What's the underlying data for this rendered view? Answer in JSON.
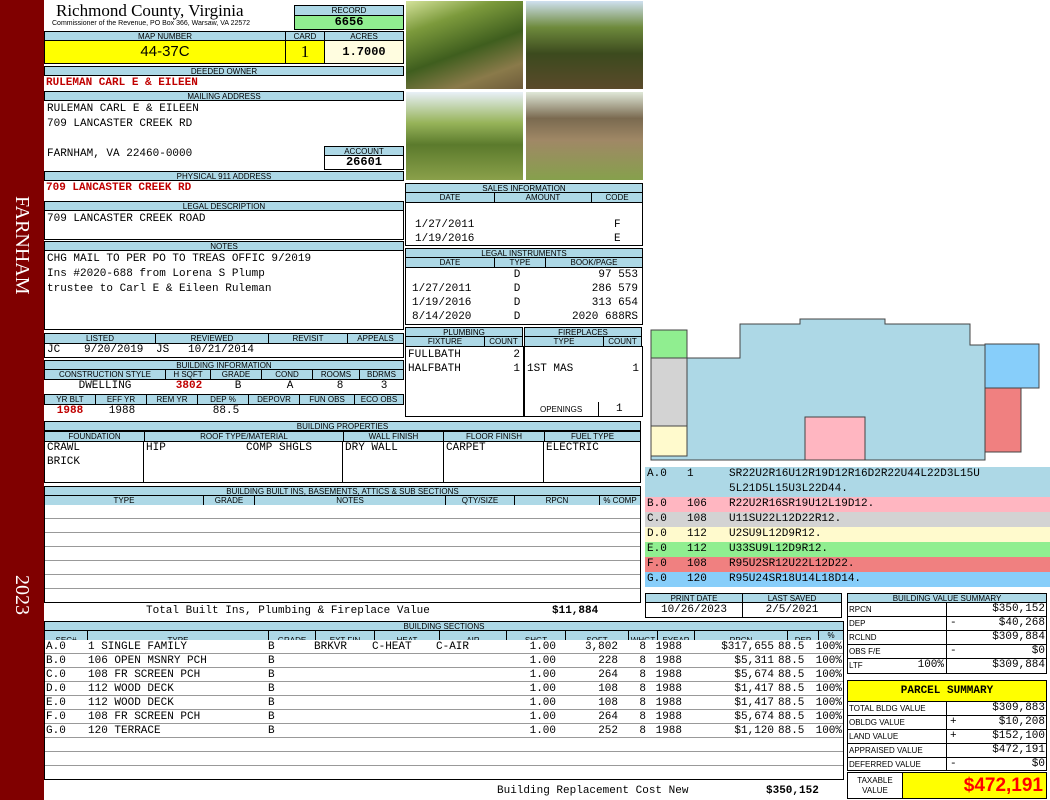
{
  "sidebar": {
    "town": "FARNHAM",
    "year": "2023",
    "color": "#800000"
  },
  "header": {
    "county": "Richmond County, Virginia",
    "office": "Commissioner of the Revenue, PO Box 366, Warsaw, VA 22572",
    "record_label": "RECORD",
    "record": "6656",
    "map_label": "MAP NUMBER",
    "map_number": "44-37C",
    "card_label": "CARD",
    "card": "1",
    "acres_label": "ACRES",
    "acres": "1.7000"
  },
  "owner": {
    "deeded_label": "DEEDED OWNER",
    "deeded": "RULEMAN CARL E & EILEEN",
    "mailing_label": "MAILING ADDRESS",
    "mail1": "RULEMAN CARL E & EILEEN",
    "mail2": "709 LANCASTER CREEK RD",
    "mail3": "FARNHAM, VA 22460-0000",
    "account_label": "ACCOUNT",
    "account": "26601",
    "physical_label": "PHYSICAL 911 ADDRESS",
    "physical": "709 LANCASTER CREEK RD",
    "legal_label": "LEGAL DESCRIPTION",
    "legal": "709 LANCASTER CREEK ROAD",
    "notes_label": "NOTES",
    "notes1": "CHG MAIL TO PER PO TO TREAS OFFIC 9/2019",
    "notes2": "Ins #2020-688 from Lorena S Plump",
    "notes3": "trustee to Carl E & Eileen Ruleman"
  },
  "sales": {
    "title": "SALES INFORMATION",
    "cols": [
      "DATE",
      "AMOUNT",
      "CODE"
    ],
    "rows": [
      {
        "date": "1/27/2011",
        "amount": "",
        "code": "F"
      },
      {
        "date": "1/19/2016",
        "amount": "",
        "code": "E"
      }
    ]
  },
  "instruments": {
    "title": "LEGAL INSTRUMENTS",
    "cols": [
      "DATE",
      "TYPE",
      "BOOK/PAGE"
    ],
    "rows": [
      {
        "date": "",
        "type": "D",
        "book": "97 553"
      },
      {
        "date": "1/27/2011",
        "type": "D",
        "book": "286 579"
      },
      {
        "date": "1/19/2016",
        "type": "D",
        "book": "313 654"
      },
      {
        "date": "8/14/2020",
        "type": "D",
        "book": "2020 688RS"
      }
    ]
  },
  "listing": {
    "cols": [
      "LISTED",
      "REVIEWED",
      "REVISIT",
      "APPEALS"
    ],
    "listed_by": "JC",
    "listed": "9/20/2019",
    "reviewed_by": "JS",
    "reviewed": "10/21/2014",
    "revisit": "",
    "appeals": ""
  },
  "building_info": {
    "title": "BUILDING INFORMATION",
    "cols1": [
      "CONSTRUCTION STYLE",
      "H SQFT",
      "GRADE",
      "COND",
      "ROOMS",
      "BDRMS"
    ],
    "style": "DWELLING",
    "hsqft": "3802",
    "grade": "B",
    "cond": "A",
    "rooms": "8",
    "bdrms": "3",
    "cols2": [
      "YR BLT",
      "EFF YR",
      "REM YR",
      "DEP %",
      "DEPOVR",
      "FUN OBS",
      "ECO OBS"
    ],
    "yrblt": "1988",
    "effyr": "1988",
    "remyr": "",
    "dep": "88.5",
    "depovr": "",
    "funobs": "",
    "ecoobs": ""
  },
  "plumbing": {
    "title": "PLUMBING",
    "cols": [
      "FIXTURE",
      "COUNT"
    ],
    "rows": [
      {
        "fixture": "FULLBATH",
        "count": "2"
      },
      {
        "fixture": "HALFBATH",
        "count": "1"
      }
    ]
  },
  "fireplaces": {
    "title": "FIREPLACES",
    "cols": [
      "TYPE",
      "COUNT"
    ],
    "rows": [
      {
        "type": "1ST MAS",
        "count": "1"
      }
    ],
    "openings_label": "OPENINGS",
    "openings": "1"
  },
  "properties": {
    "title": "BUILDING PROPERTIES",
    "cols": [
      "FOUNDATION",
      "ROOF TYPE/MATERIAL",
      "WALL FINISH",
      "FLOOR FINISH",
      "FUEL TYPE"
    ],
    "foundation1": "CRAWL",
    "foundation2": "BRICK",
    "roof_type": "HIP",
    "roof_material": "COMP SHGLS",
    "wall": "DRY WALL",
    "floor": "CARPET",
    "fuel": "ELECTRIC"
  },
  "builtins": {
    "title": "BUILDING BUILT INS, BASEMENTS, ATTICS & SUB SECTIONS",
    "cols": [
      "TYPE",
      "GRADE",
      "NOTES",
      "QTY/SIZE",
      "RPCN",
      "% COMP"
    ],
    "total_label": "Total Built Ins, Plumbing & Fireplace Value",
    "total": "$11,884"
  },
  "sketch": {
    "lines": [
      {
        "code": "A.0",
        "num": "1",
        "text": "SR22U2R16U12R19D12R16D2R22U44L22D3L15U",
        "bg": "#add8e6"
      },
      {
        "code": "",
        "num": "",
        "text": "5L21D5L15U3L22D44.",
        "bg": "#add8e6"
      },
      {
        "code": "B.0",
        "num": "106",
        "text": "R22U2R16SR19U12L19D12.",
        "bg": "#ffb6c1"
      },
      {
        "code": "C.0",
        "num": "108",
        "text": "U11SU22L12D22R12.",
        "bg": "#d3d3d3"
      },
      {
        "code": "D.0",
        "num": "112",
        "text": "U2SU9L12D9R12.",
        "bg": "#fffacd"
      },
      {
        "code": "E.0",
        "num": "112",
        "text": "U33SU9L12D9R12.",
        "bg": "#90ee90"
      },
      {
        "code": "F.0",
        "num": "108",
        "text": "R95U2SR12U22L12D22.",
        "bg": "#f08080"
      },
      {
        "code": "G.0",
        "num": "120",
        "text": "R95U24SR18U14L18D14.",
        "bg": "#87cefa"
      }
    ]
  },
  "dates": {
    "print_label": "PRINT DATE",
    "print": "10/26/2023",
    "saved_label": "LAST SAVED",
    "saved": "2/5/2021"
  },
  "sections": {
    "title": "BUILDING SECTIONS",
    "cols": [
      "SEC#",
      "TYPE",
      "GRADE",
      "EXT FIN",
      "HEAT",
      "AIR",
      "SHGT",
      "SQFT",
      "WHGT",
      "EYEAR",
      "RPCN",
      "DEP",
      "% COMP"
    ],
    "rows": [
      {
        "sec": "A.0",
        "type": "1 SINGLE FAMILY",
        "grade": "B",
        "ext": "BRKVR",
        "heat": "C-HEAT",
        "air": "C-AIR",
        "shgt": "1.00",
        "sqft": "3,802",
        "whgt": "8",
        "eyear": "1988",
        "rpcn": "$317,655",
        "dep": "88.5",
        "comp": "100%"
      },
      {
        "sec": "B.0",
        "type": "106 OPEN MSNRY PCH",
        "grade": "B",
        "ext": "",
        "heat": "",
        "air": "",
        "shgt": "1.00",
        "sqft": "228",
        "whgt": "8",
        "eyear": "1988",
        "rpcn": "$5,311",
        "dep": "88.5",
        "comp": "100%"
      },
      {
        "sec": "C.0",
        "type": "108 FR SCREEN PCH",
        "grade": "B",
        "ext": "",
        "heat": "",
        "air": "",
        "shgt": "1.00",
        "sqft": "264",
        "whgt": "8",
        "eyear": "1988",
        "rpcn": "$5,674",
        "dep": "88.5",
        "comp": "100%"
      },
      {
        "sec": "D.0",
        "type": "112 WOOD DECK",
        "grade": "B",
        "ext": "",
        "heat": "",
        "air": "",
        "shgt": "1.00",
        "sqft": "108",
        "whgt": "8",
        "eyear": "1988",
        "rpcn": "$1,417",
        "dep": "88.5",
        "comp": "100%"
      },
      {
        "sec": "E.0",
        "type": "112 WOOD DECK",
        "grade": "B",
        "ext": "",
        "heat": "",
        "air": "",
        "shgt": "1.00",
        "sqft": "108",
        "whgt": "8",
        "eyear": "1988",
        "rpcn": "$1,417",
        "dep": "88.5",
        "comp": "100%"
      },
      {
        "sec": "F.0",
        "type": "108 FR SCREEN PCH",
        "grade": "B",
        "ext": "",
        "heat": "",
        "air": "",
        "shgt": "1.00",
        "sqft": "264",
        "whgt": "8",
        "eyear": "1988",
        "rpcn": "$5,674",
        "dep": "88.5",
        "comp": "100%"
      },
      {
        "sec": "G.0",
        "type": "120 TERRACE",
        "grade": "B",
        "ext": "",
        "heat": "",
        "air": "",
        "shgt": "1.00",
        "sqft": "252",
        "whgt": "8",
        "eyear": "1988",
        "rpcn": "$1,120",
        "dep": "88.5",
        "comp": "100%"
      }
    ],
    "brcn_label": "Building Replacement Cost New",
    "brcn": "$350,152"
  },
  "value_summary": {
    "title": "BUILDING VALUE SUMMARY",
    "rpcn_label": "RPCN",
    "rpcn": "$350,152",
    "dep_label": "DEP",
    "dep_sign": "-",
    "dep": "$40,268",
    "rclnd_label": "RCLND",
    "rclnd": "$309,884",
    "obs_label": "OBS F/E",
    "obs_sign": "-",
    "obs": "$0",
    "ltf_label": "LTF",
    "ltf_pct": "100%",
    "ltf": "$309,884"
  },
  "parcel": {
    "title": "PARCEL SUMMARY",
    "bldg_label": "TOTAL BLDG VALUE",
    "bldg": "$309,883",
    "obldg_label": "OBLDG VALUE",
    "obldg_sign": "+",
    "obldg": "$10,208",
    "land_label": "LAND VALUE",
    "land_sign": "+",
    "land": "$152,100",
    "appraised_label": "APPRAISED VALUE",
    "appraised": "$472,191",
    "deferred_label": "DEFERRED VALUE",
    "deferred_sign": "-",
    "deferred": "$0",
    "taxable_label1": "TAXABLE",
    "taxable_label2": "VALUE",
    "taxable": "$472,191"
  }
}
